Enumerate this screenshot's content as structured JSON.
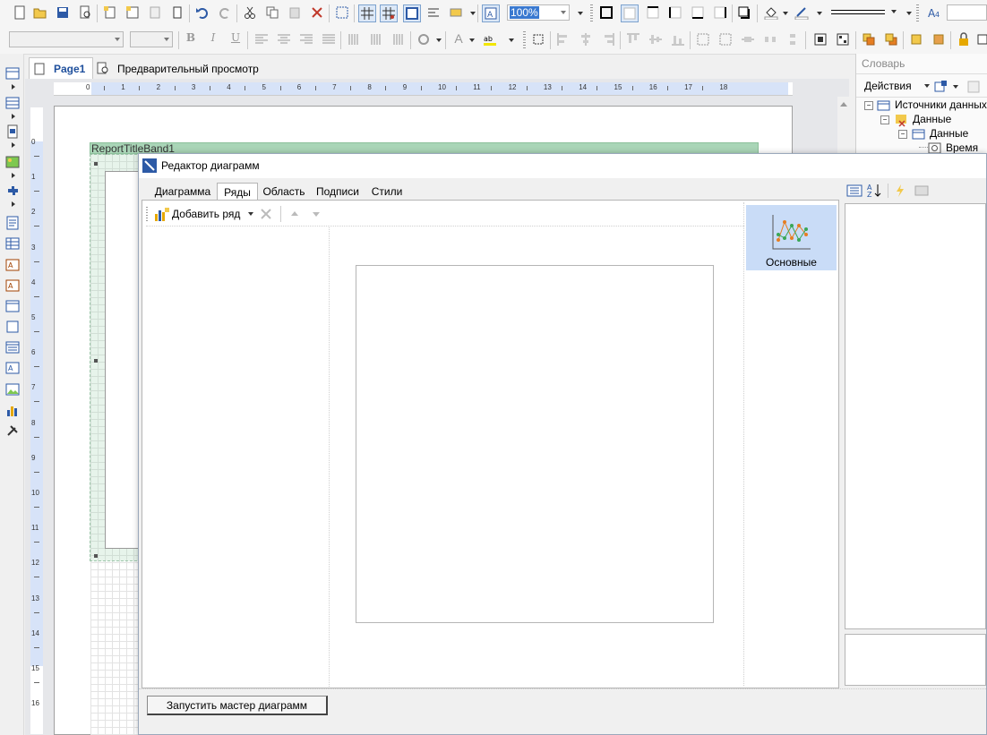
{
  "toolbar": {
    "zoom_value": "100%"
  },
  "tabs": {
    "page1": "Page1",
    "preview": "Предварительный просмотр"
  },
  "ruler": {
    "h_ticks": [
      "0",
      "1",
      "2",
      "3",
      "4",
      "5",
      "6",
      "7",
      "8",
      "9",
      "10",
      "11",
      "12",
      "13",
      "14",
      "15",
      "16",
      "17",
      "18"
    ],
    "v_ticks": [
      "0",
      "1",
      "2",
      "3",
      "4",
      "5",
      "6",
      "7",
      "8",
      "9",
      "10",
      "11",
      "12",
      "13",
      "14",
      "15",
      "16"
    ]
  },
  "band": {
    "name": "ReportTitleBand1"
  },
  "dictionary": {
    "title": "Словарь",
    "actions": "Действия",
    "tree": {
      "sources": "Источники данных",
      "data1": "Данные",
      "data2": "Данные",
      "time": "Время"
    }
  },
  "dialog": {
    "title": "Редактор диаграмм",
    "tabs": [
      "Диаграмма",
      "Ряды",
      "Область",
      "Подписи",
      "Стили"
    ],
    "active_tab": "Ряды",
    "add_series": "Добавить ряд",
    "gallery_item": "Основные",
    "wizard_button": "Запустить мастер диаграмм"
  }
}
